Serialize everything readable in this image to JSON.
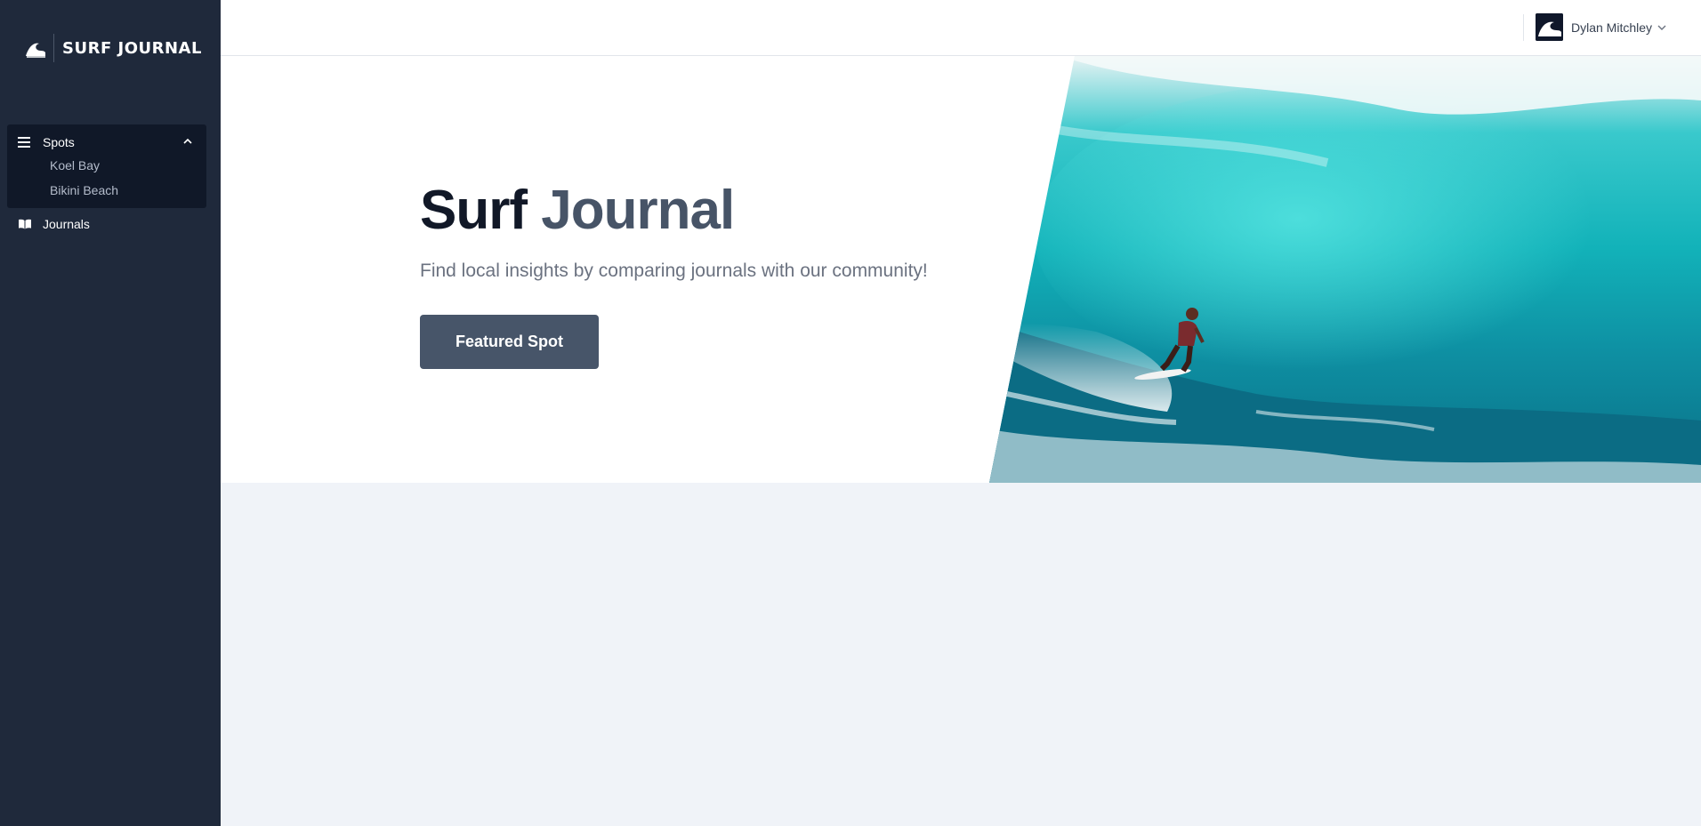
{
  "brand": {
    "name": "SURF JOURNAL",
    "icon": "wave-logo-icon"
  },
  "sidebar": {
    "spots": {
      "label": "Spots",
      "icon": "menu-icon",
      "expanded": true,
      "items": [
        {
          "label": "Koel Bay"
        },
        {
          "label": "Bikini Beach"
        }
      ]
    },
    "journals": {
      "label": "Journals",
      "icon": "book-open-icon"
    }
  },
  "header": {
    "user": {
      "name": "Dylan Mitchley",
      "avatar_icon": "wave-avatar-icon"
    }
  },
  "hero": {
    "title_part1": "Surf",
    "title_part2": "Journal",
    "subtitle": "Find local insights by comparing journals with our community!",
    "cta_label": "Featured Spot"
  },
  "colors": {
    "sidebar_bg": "#1f293b",
    "sidebar_active_bg": "#101828",
    "button_bg": "#475569",
    "title_dark": "#111827",
    "title_accent": "#475467",
    "page_bg": "#f0f3f8"
  }
}
